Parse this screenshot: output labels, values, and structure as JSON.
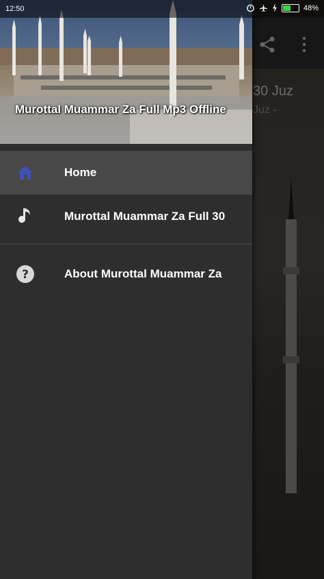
{
  "status_bar": {
    "time": "12:50",
    "battery_percent": "48%",
    "battery_level": 0.48
  },
  "background_screen": {
    "title_line1": "30 Juz",
    "title_line2": "Juz -"
  },
  "drawer": {
    "header_title": "Murottal Muammar Za Full Mp3 Offline",
    "items": [
      {
        "label": "Home",
        "icon": "home-icon",
        "active": true
      },
      {
        "label": "Murottal Muammar Za Full 30",
        "icon": "music-note-icon",
        "active": false
      },
      {
        "label": "About Murottal Muammar Za",
        "icon": "help-circle-icon",
        "active": false
      }
    ]
  },
  "colors": {
    "drawer_bg": "#2e2e2e",
    "active_item_bg": "#484848",
    "home_icon": "#3f51b5",
    "battery_fill": "#37d53a"
  }
}
